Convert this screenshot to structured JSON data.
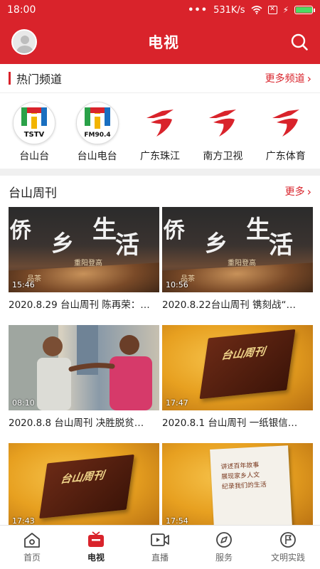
{
  "status_bar": {
    "time": "18:00",
    "dots": "•••",
    "speed": "531K/s",
    "x_box": "✕",
    "bolt": "⚡",
    "battery_level": 0.95
  },
  "header": {
    "title": "电视",
    "avatar_icon": "avatar-icon",
    "search_icon": "search-icon"
  },
  "hot_channels": {
    "title": "热门频道",
    "more_label": "更多频道",
    "chevron": "›",
    "items": [
      {
        "name": "台山台",
        "logo_text": "TSTV"
      },
      {
        "name": "台山电台",
        "logo_text": "FM90.4"
      },
      {
        "name": "广东珠江"
      },
      {
        "name": "南方卫视"
      },
      {
        "name": "广东体育"
      }
    ]
  },
  "weekly": {
    "title": "台山周刊",
    "more_label": "更多",
    "chevron": "›",
    "thumb_text": {
      "qiao": "侨",
      "xiang": "乡",
      "sheng": "生",
      "huo": "活",
      "sub1": "重阳登高",
      "sub2": "品茶",
      "book_logo": "台山周刊",
      "page_line1": "讲述百年故事",
      "page_line2": "展现家乡人文",
      "page_line3": "纪录我们的生活"
    },
    "videos": [
      {
        "duration": "15:46",
        "caption": "2020.8.29 台山周刊 陈再荣：…"
      },
      {
        "duration": "10:56",
        "caption": "2020.8.22台山周刊 镌刻战“…"
      },
      {
        "duration": "08:10",
        "caption": "2020.8.8 台山周刊 决胜脱贫…"
      },
      {
        "duration": "17:47",
        "caption": "2020.8.1 台山周刊 一纸银信…"
      },
      {
        "duration": "17:43",
        "caption": ""
      },
      {
        "duration": "17:54",
        "caption": ""
      }
    ]
  },
  "bottom_nav": {
    "items": [
      {
        "label": "首页",
        "icon": "home-icon"
      },
      {
        "label": "电视",
        "icon": "tv-icon",
        "active": true
      },
      {
        "label": "直播",
        "icon": "live-icon"
      },
      {
        "label": "服务",
        "icon": "compass-icon"
      },
      {
        "label": "文明实践",
        "icon": "flag-icon"
      }
    ]
  },
  "colors": {
    "brand_red": "#d9232b",
    "text": "#222222",
    "muted": "#666666"
  }
}
